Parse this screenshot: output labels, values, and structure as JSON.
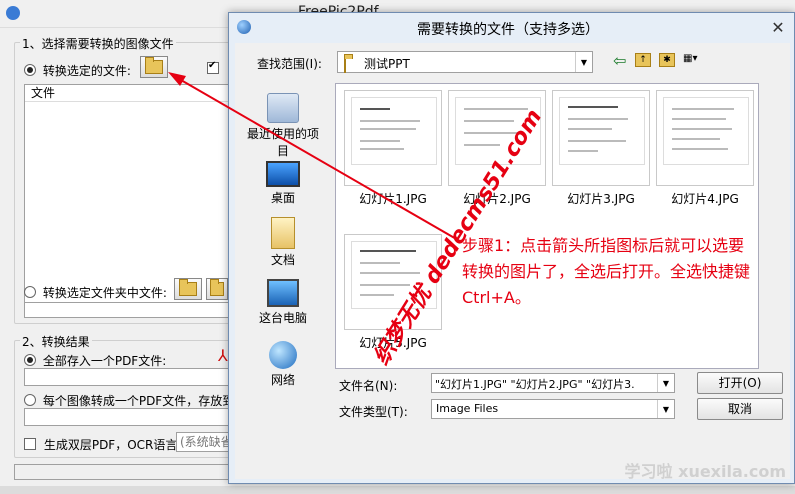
{
  "main_window": {
    "title": "FreePic2Pdf",
    "section1_label": "1、选择需要转换的图像文件",
    "radio_selected_files": "转换选定的文件:",
    "file_list_header": "文件",
    "radio_folder": "转换选定文件夹中文件:",
    "section2_label": "2、转换结果",
    "radio_single_pdf": "全部存入一个PDF文件:",
    "radio_each_pdf": "每个图像转成一个PDF文件，存放到",
    "checkbox_ocr": "生成双层PDF，OCR语言:",
    "ocr_lang_value": "(系统缺省"
  },
  "dialog": {
    "title": "需要转换的文件（支持多选）",
    "look_in_label": "查找范围(I):",
    "look_in_value": "测试PPT",
    "nav": [
      {
        "label": "最近使用的项目",
        "icon": "recent-items-icon"
      },
      {
        "label": "桌面",
        "icon": "desktop-icon"
      },
      {
        "label": "文档",
        "icon": "documents-icon"
      },
      {
        "label": "这台电脑",
        "icon": "computer-icon"
      },
      {
        "label": "网络",
        "icon": "network-icon"
      }
    ],
    "files": [
      {
        "name": "幻灯片1.JPG"
      },
      {
        "name": "幻灯片2.JPG"
      },
      {
        "name": "幻灯片3.JPG"
      },
      {
        "name": "幻灯片4.JPG"
      },
      {
        "name": "幻灯片5.JPG"
      }
    ],
    "filename_label": "文件名(N):",
    "filename_value": "\"幻灯片1.JPG\" \"幻灯片2.JPG\" \"幻灯片3.",
    "filetype_label": "文件类型(T):",
    "filetype_value": "Image Files",
    "open_button": "打开(O)",
    "cancel_button": "取消"
  },
  "annotation": {
    "text": "步骤1：点击箭头所指图标后就可以选要转换的图片了，全选后打开。全选快捷键Ctrl+A。",
    "watermark": "织梦无忧 dedecms51.com",
    "corner_watermark": "学习啦 xuexila.com",
    "color": "#e60012"
  }
}
